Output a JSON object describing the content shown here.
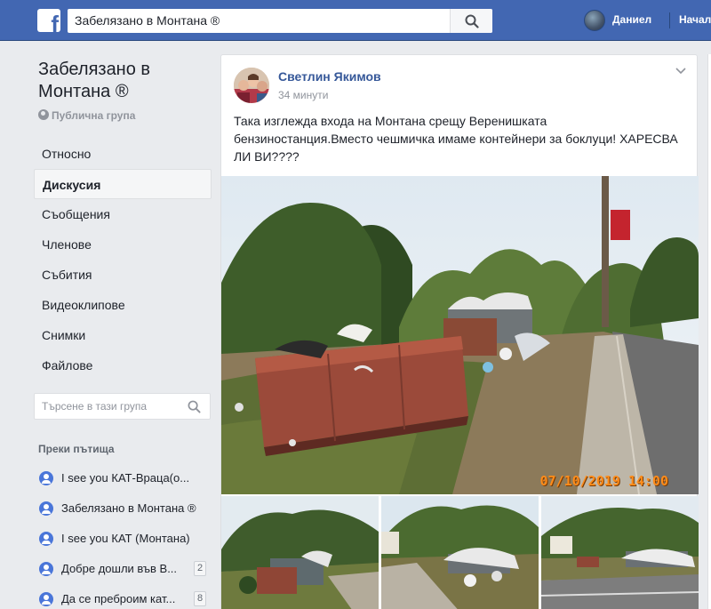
{
  "topbar": {
    "logo_letter": "f",
    "search_value": "Забелязано в Монтана ®",
    "user_name": "Даниел",
    "home_label": "Начало"
  },
  "group": {
    "title": "Забелязано в Монтана ®",
    "privacy": "Публична група"
  },
  "nav": {
    "items": [
      {
        "label": "Относно",
        "active": false
      },
      {
        "label": "Дискусия",
        "active": true
      },
      {
        "label": "Съобщения",
        "active": false
      },
      {
        "label": "Членове",
        "active": false
      },
      {
        "label": "Събития",
        "active": false
      },
      {
        "label": "Видеоклипове",
        "active": false
      },
      {
        "label": "Снимки",
        "active": false
      },
      {
        "label": "Файлове",
        "active": false
      }
    ]
  },
  "group_search": {
    "placeholder": "Търсене в тази група"
  },
  "shortcuts": {
    "header": "Преки пътища",
    "items": [
      {
        "label": "I see you КАТ-Враца(о...",
        "badge": ""
      },
      {
        "label": "Забелязано в Монтана ®",
        "badge": ""
      },
      {
        "label": "I see you КАТ (Монтана)",
        "badge": ""
      },
      {
        "label": "Добре дошли във В...",
        "badge": "2"
      },
      {
        "label": "Да се преброим кат...",
        "badge": "8"
      }
    ]
  },
  "post": {
    "author": "Светлин Якимов",
    "time": "34 минути",
    "text": "Така изглежда входа на Монтана срещу Веренишката бензиностанция.Вместо чешмичка имаме контейнери за боклуци! ХАРЕСВА ЛИ ВИ????",
    "photo_date": "07/10/2019 14:00"
  },
  "colors": {
    "topbar": "#4267b2",
    "link": "#365899",
    "background": "#e9ebee"
  }
}
